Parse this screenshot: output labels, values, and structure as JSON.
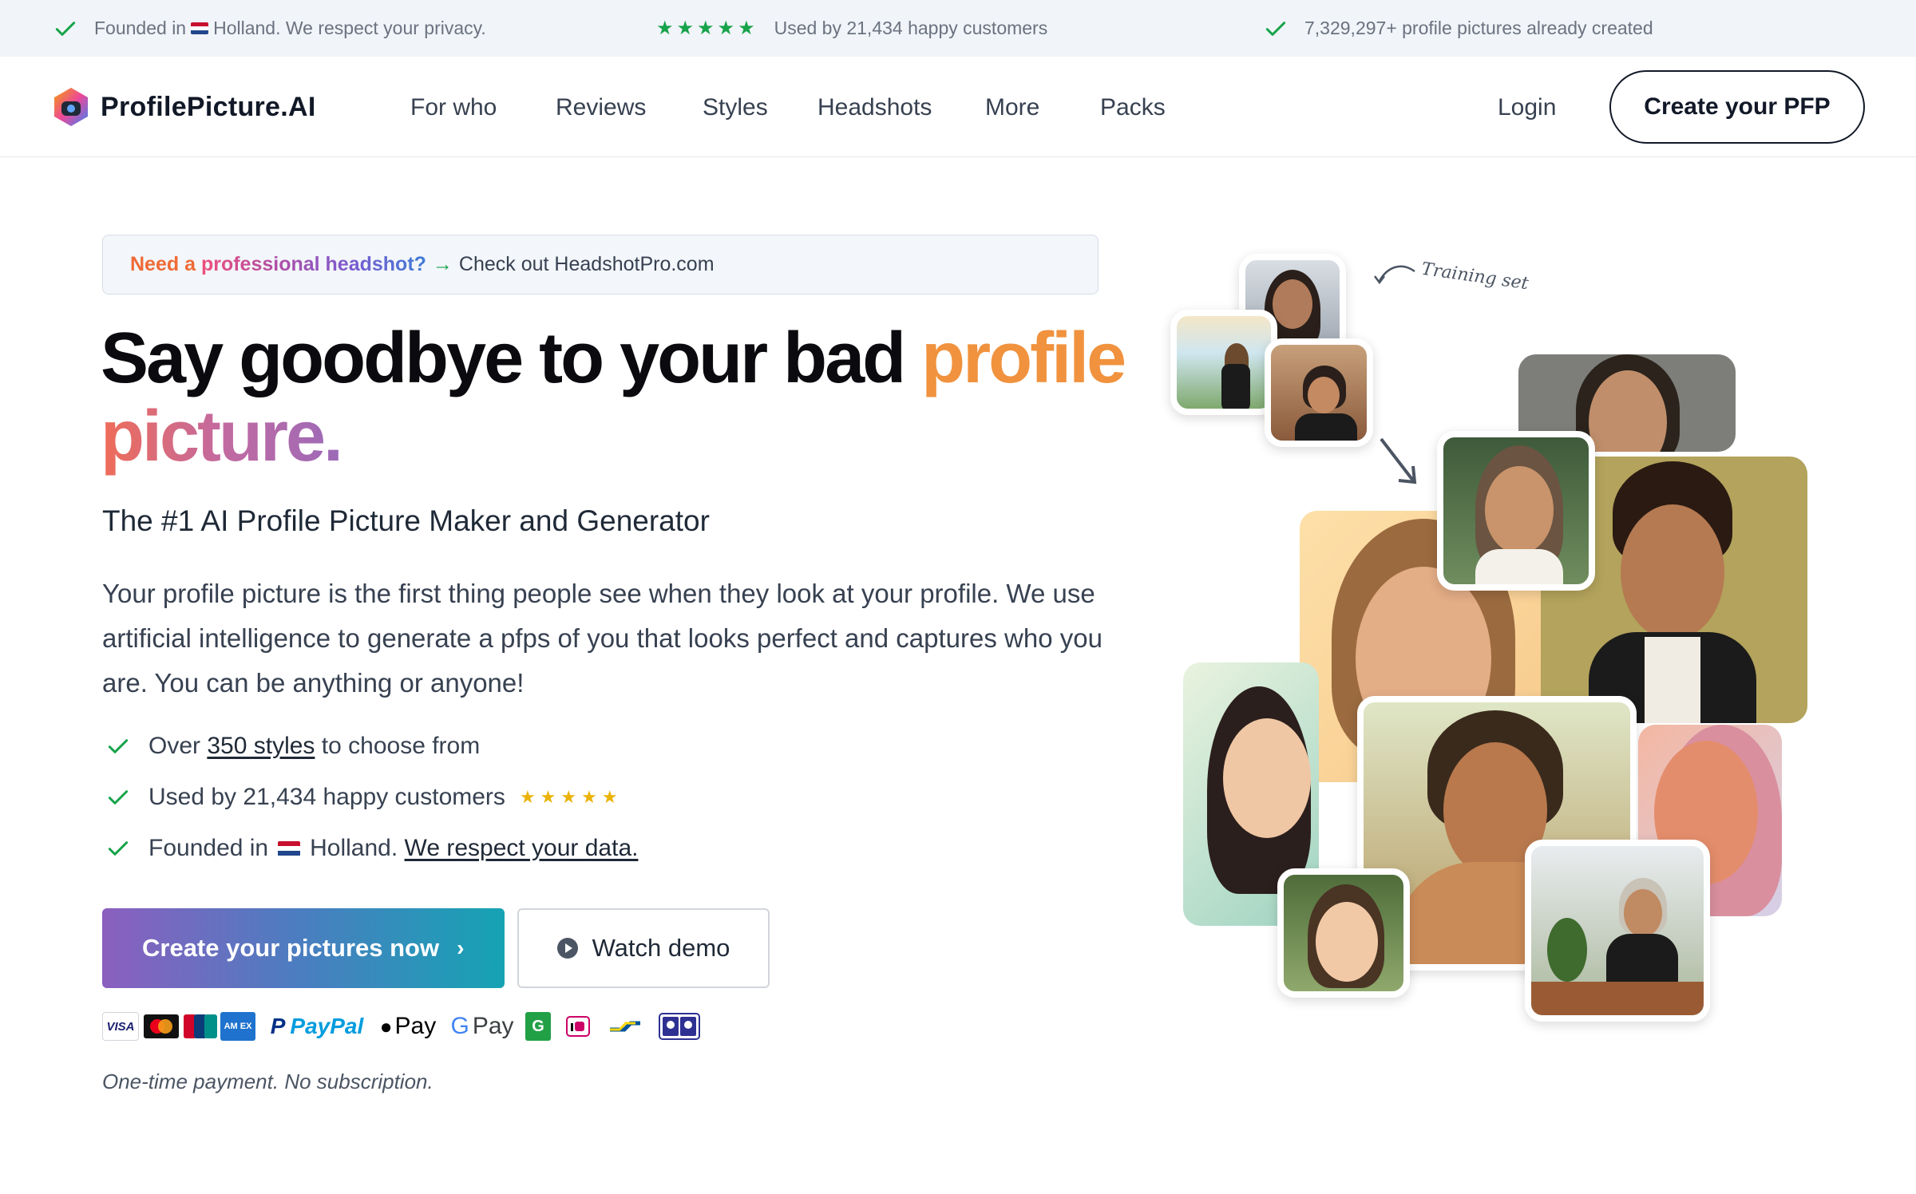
{
  "topbar": {
    "item1_pre": "Founded in",
    "item1_post": "Holland. We respect your privacy.",
    "item2": "Used by 21,434 happy customers",
    "item3": "7,329,297+ profile pictures already created",
    "stars": "★★★★★"
  },
  "nav": {
    "logo": "ProfilePicture.AI",
    "links": [
      "For who",
      "Reviews",
      "Styles",
      "Headshots",
      "More",
      "Packs"
    ],
    "login": "Login",
    "cta": "Create your PFP"
  },
  "banner": {
    "need": "Need a",
    "professional": "professional headshot?",
    "arrow": "→",
    "rest": "Check out HeadshotPro.com"
  },
  "hero": {
    "title_main": "Say goodbye to your bad",
    "title_accent1": "profile",
    "title_accent2": "picture.",
    "subtitle": "The #1 AI Profile Picture Maker and Generator",
    "paragraph": "Your profile picture is the first thing people see when they look at your profile. We use artificial intelligence to generate a pfps of you that looks perfect and captures who you are. You can be anything or anyone!"
  },
  "features": {
    "f1_pre": "Over",
    "f1_link": "350 styles",
    "f1_post": "to choose from",
    "f2": "Used by 21,434 happy customers",
    "f2_stars": "★★★★★",
    "f3_pre": "Founded in",
    "f3_mid": "Holland.",
    "f3_link": "We respect your data."
  },
  "buttons": {
    "primary": "Create your pictures now",
    "primary_chevron": "›",
    "demo": "Watch demo"
  },
  "payments": {
    "visa": "VISA",
    "paypal": "PayPal",
    "applepay": "Pay",
    "googlepay": "Pay",
    "g": "G",
    "amex": "AM EX"
  },
  "note": "One-time payment. No subscription.",
  "collage": {
    "training_label": "Training set"
  },
  "colors": {
    "check_green": "#16a34a",
    "orange": "#f0923e",
    "star_yellow": "#eab308"
  },
  "icons": {
    "check": "check-icon",
    "play": "play-circle-icon",
    "logo": "logo-icon"
  }
}
